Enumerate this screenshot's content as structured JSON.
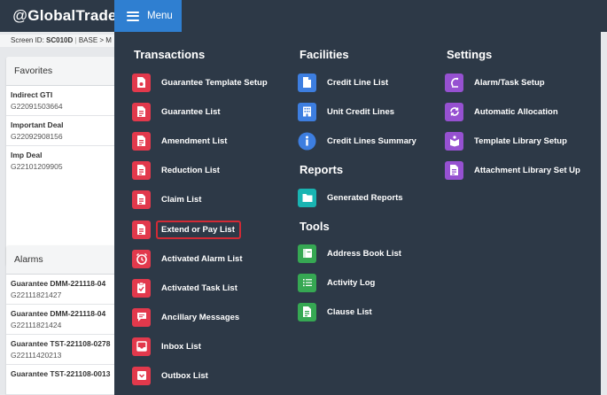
{
  "app": {
    "brand_prefix": "@",
    "brand_name": "GlobalTrade",
    "menu_label": "Menu"
  },
  "screen": {
    "id_label": "Screen ID:",
    "id_value": "SC010D",
    "breadcrumb": "BASE > M"
  },
  "favorites": {
    "title": "Favorites",
    "items": [
      {
        "title": "Indirect GTI",
        "sub": "G22091503664"
      },
      {
        "title": "Important Deal",
        "sub": "G22092908156"
      },
      {
        "title": "Imp Deal",
        "sub": "G22101209905"
      }
    ]
  },
  "alarms": {
    "title": "Alarms",
    "items": [
      {
        "title": "Guarantee DMM-221118-04",
        "sub": "G22111821427"
      },
      {
        "title": "Guarantee DMM-221118-04",
        "sub": "G22111821424"
      },
      {
        "title": "Guarantee TST-221108-0278",
        "sub": "G22111420213"
      },
      {
        "title": "Guarantee TST-221108-0013",
        "sub": ""
      }
    ]
  },
  "menu": {
    "transactions": {
      "title": "Transactions",
      "items": [
        {
          "label": "Guarantee Template Setup",
          "icon": "template-doc-icon"
        },
        {
          "label": "Guarantee List",
          "icon": "list-doc-icon"
        },
        {
          "label": "Amendment List",
          "icon": "list-doc-icon"
        },
        {
          "label": "Reduction List",
          "icon": "list-doc-icon"
        },
        {
          "label": "Claim List",
          "icon": "list-doc-icon"
        },
        {
          "label": "Extend or Pay List",
          "icon": "list-doc-icon"
        },
        {
          "label": "Activated Alarm List",
          "icon": "alarm-clock-icon"
        },
        {
          "label": "Activated Task List",
          "icon": "task-check-icon"
        },
        {
          "label": "Ancillary Messages",
          "icon": "message-icon"
        },
        {
          "label": "Inbox List",
          "icon": "inbox-icon"
        },
        {
          "label": "Outbox List",
          "icon": "outbox-icon"
        }
      ]
    },
    "facilities": {
      "title": "Facilities",
      "items": [
        {
          "label": "Credit Line List",
          "icon": "document-icon"
        },
        {
          "label": "Unit Credit Lines",
          "icon": "building-icon"
        },
        {
          "label": "Credit Lines Summary",
          "icon": "info-icon"
        }
      ]
    },
    "reports": {
      "title": "Reports",
      "items": [
        {
          "label": "Generated Reports",
          "icon": "folder-icon"
        }
      ]
    },
    "tools": {
      "title": "Tools",
      "items": [
        {
          "label": "Address Book List",
          "icon": "address-book-icon"
        },
        {
          "label": "Activity Log",
          "icon": "log-list-icon"
        },
        {
          "label": "Clause List",
          "icon": "clause-doc-icon"
        }
      ]
    },
    "settings": {
      "title": "Settings",
      "items": [
        {
          "label": "Alarm/Task Setup",
          "icon": "alarm-setup-icon"
        },
        {
          "label": "Automatic Allocation",
          "icon": "sync-icon"
        },
        {
          "label": "Template Library Setup",
          "icon": "library-icon"
        },
        {
          "label": "Attachment Library Set Up",
          "icon": "attachment-doc-icon"
        }
      ]
    }
  },
  "colors": {
    "topbar": "#2d3947",
    "menu_button": "#2f7fd1",
    "transactions_icon": "#e2394c",
    "facilities_icon": "#3d7ee0",
    "reports_icon": "#19b4b2",
    "tools_icon": "#36a853",
    "settings_icon": "#9651d1",
    "highlight": "#d32a35"
  }
}
